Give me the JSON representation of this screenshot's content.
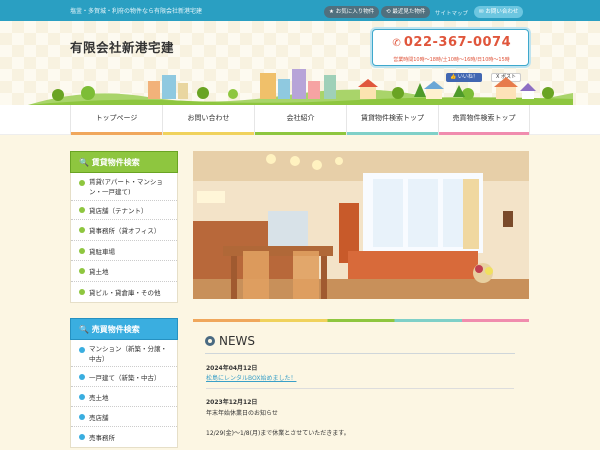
{
  "topbar": {
    "tagline": "塩釜・多賀城・利府の物件なら有限会社新港宅建",
    "favorites_label": "お気に入り物件",
    "recent_label": "最近見た物件",
    "sitemap_label": "サイトマップ",
    "contact_label": "お問い合わせ"
  },
  "header": {
    "company_name": "有限会社新港宅建",
    "phone": "022-367-0074",
    "hours": "営業時間10時～18時/土10時～16時/日10時～15時",
    "fb_like": "いいね！",
    "x_post": "ポスト"
  },
  "nav": [
    {
      "label": "トップページ",
      "color": "#f0a75c"
    },
    {
      "label": "お問い合わせ",
      "color": "#f0d25c"
    },
    {
      "label": "会社紹介",
      "color": "#8ec63f"
    },
    {
      "label": "賃貸物件検索トップ",
      "color": "#7fd0c8"
    },
    {
      "label": "売買物件検索トップ",
      "color": "#f08cae"
    }
  ],
  "sidebar": {
    "rental_title": "賃貸物件検索",
    "rental_items": [
      "賃貸(アパート・マンション・一戸建て)",
      "貸店舗（テナント）",
      "貸事務所（貸オフィス）",
      "貸駐車場",
      "貸土地",
      "貸ビル・貸倉庫・その他"
    ],
    "sale_title": "売買物件検索",
    "sale_items": [
      "マンション（新築・分譲・中古）",
      "一戸建て（新築・中古）",
      "売土地",
      "売店舗",
      "売事務所"
    ]
  },
  "news": {
    "title": "NEWS",
    "items": [
      {
        "date": "2024年04月12日",
        "text": "松島にレンタルBOX始めました！",
        "link": true
      },
      {
        "date": "2023年12月12日",
        "text": "年末年始休業日のお知らせ",
        "link": false
      }
    ],
    "note": "12/29(金)～1/8(月)まで休業とさせていただきます。"
  },
  "colors": {
    "topbar": "#2a9fc2",
    "phone": "#e0563c",
    "rental_green": "#8ec63f",
    "sale_blue": "#3aaee0"
  }
}
